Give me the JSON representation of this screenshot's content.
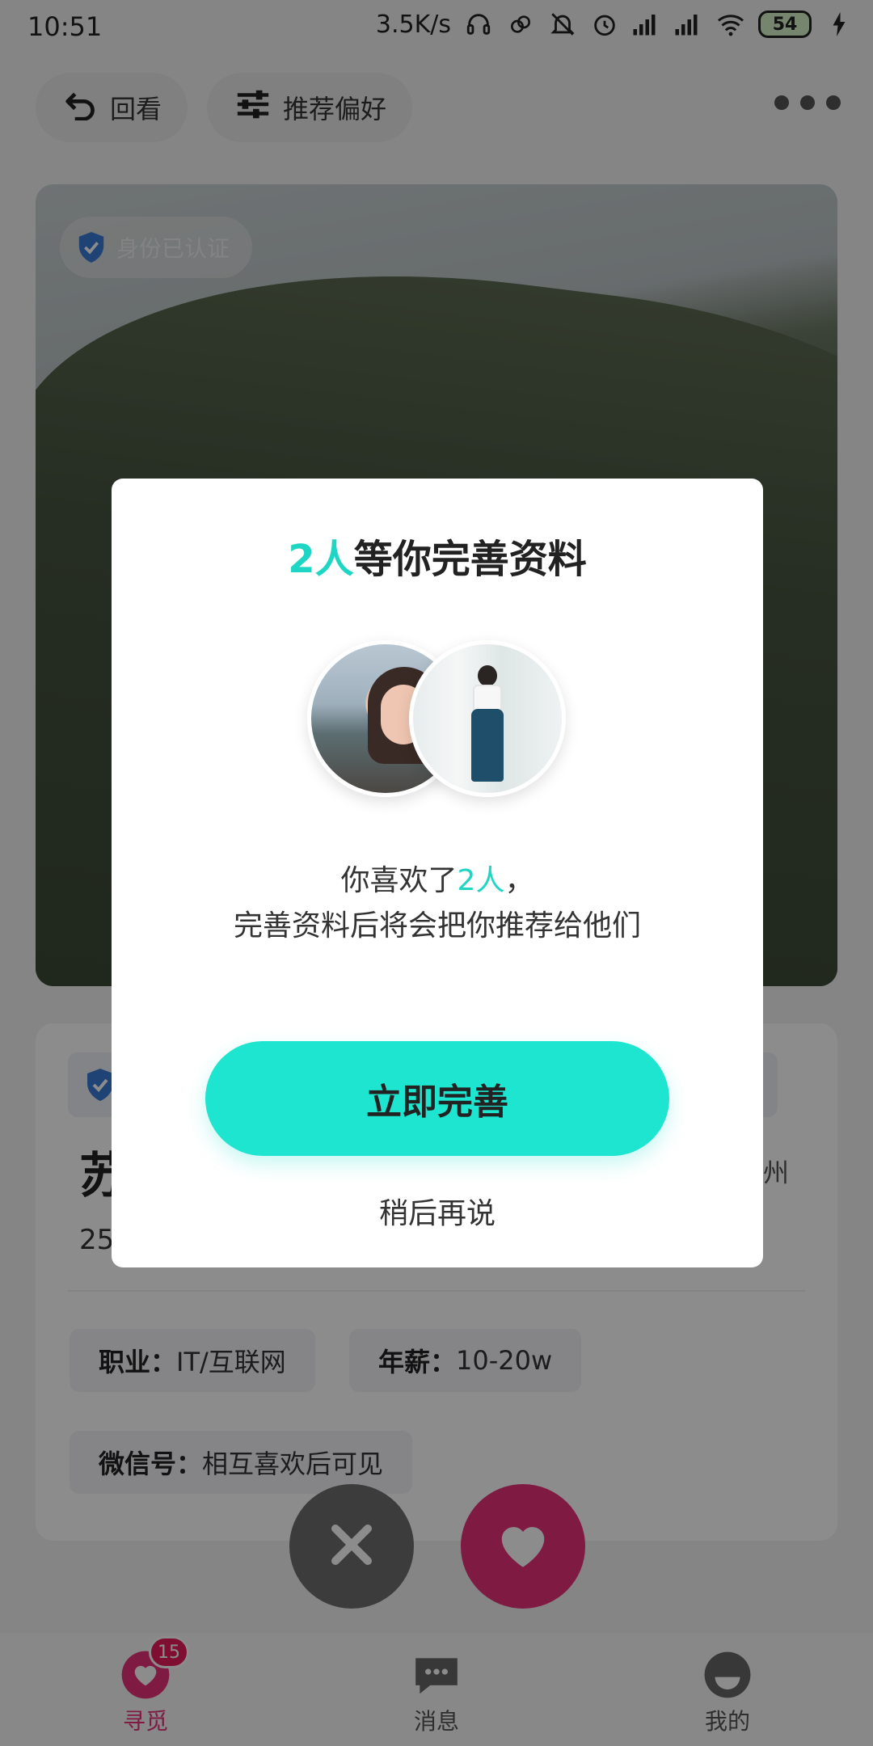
{
  "status_bar": {
    "time": "10:51",
    "net_speed": "3.5K/s",
    "battery": "54",
    "icons": [
      "headset-icon",
      "link-icon",
      "mute-icon",
      "alarm-icon",
      "signal-icon",
      "signal-icon",
      "wifi-icon",
      "battery-icon",
      "charging-icon"
    ]
  },
  "top_bar": {
    "back_label": "回看",
    "pref_label": "推荐偏好"
  },
  "profile": {
    "verified_label": "身份已认证",
    "name": "苏",
    "location": "州",
    "age": "25",
    "tags": [
      {
        "key": "职业：",
        "value": "IT/互联网"
      },
      {
        "key": "年薪：",
        "value": "10-20w"
      },
      {
        "key": "微信号：",
        "value": "相互喜欢后可见"
      }
    ]
  },
  "tabs": [
    {
      "label": "寻觅",
      "badge": "15",
      "icon": "heart-search-icon"
    },
    {
      "label": "消息",
      "icon": "chat-icon"
    },
    {
      "label": "我的",
      "icon": "profile-icon"
    }
  ],
  "modal": {
    "title_accent": "2人",
    "title_rest": "等你完善资料",
    "desc_line1_pre": "你喜欢了",
    "desc_line1_accent": "2人",
    "desc_line1_post": "，",
    "desc_line2": "完善资料后将会把你推荐给他们",
    "primary_button": "立即完善",
    "secondary_button": "稍后再说"
  },
  "colors": {
    "accent": "#1ee5cf",
    "like": "#e8307a",
    "badge": "#e61d5c"
  }
}
